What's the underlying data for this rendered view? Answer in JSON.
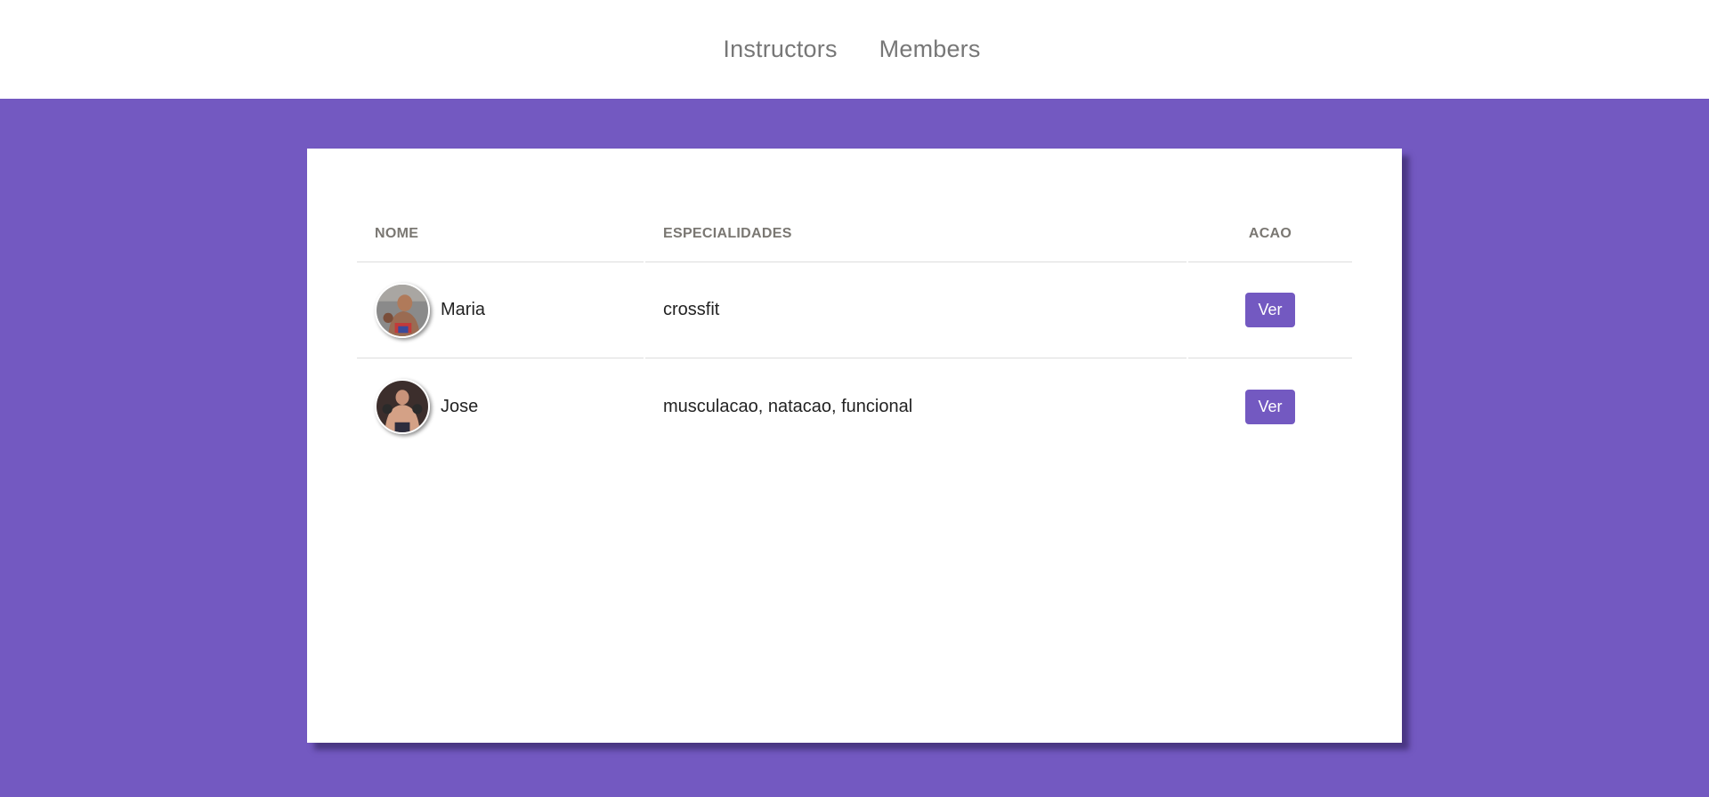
{
  "nav": {
    "items": [
      {
        "label": "Instructors"
      },
      {
        "label": "Members"
      }
    ]
  },
  "table": {
    "headers": {
      "name": "NOME",
      "specialties": "ESPECIALIDADES",
      "action": "ACAO"
    },
    "rows": [
      {
        "name": "Maria",
        "specialties": "crossfit",
        "action_label": "Ver"
      },
      {
        "name": "Jose",
        "specialties": "musculacao, natacao, funcional",
        "action_label": "Ver"
      }
    ]
  },
  "colors": {
    "accent": "#7359c1",
    "header_bg": "#ffffff",
    "nav_text": "#777777",
    "table_header_text": "#7a7772"
  }
}
